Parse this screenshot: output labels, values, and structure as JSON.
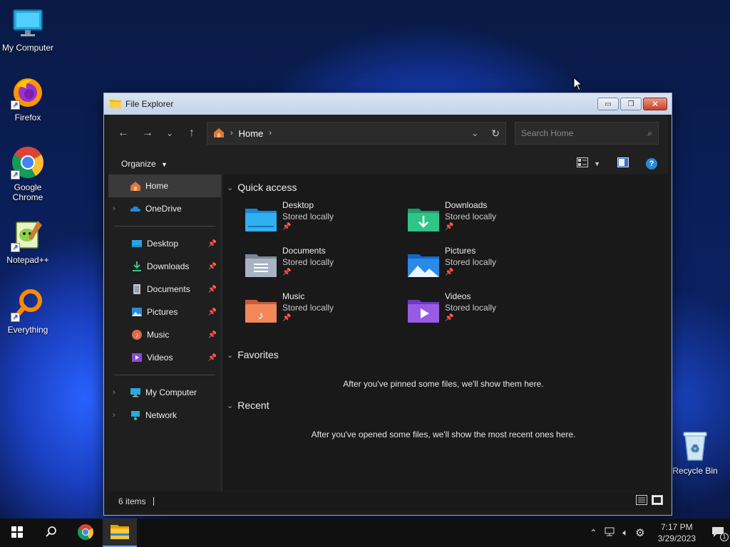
{
  "desktop": {
    "icons": [
      {
        "label": "My Computer"
      },
      {
        "label": "Firefox"
      },
      {
        "label": "Google Chrome"
      },
      {
        "label": "Notepad++"
      },
      {
        "label": "Everything"
      },
      {
        "label": "Recycle Bin"
      }
    ]
  },
  "window": {
    "title": "File Explorer",
    "address": {
      "location": "Home"
    },
    "search": {
      "placeholder": "Search Home"
    },
    "toolbar": {
      "organize_label": "Organize"
    },
    "sidebar": {
      "items": [
        {
          "label": "Home"
        },
        {
          "label": "OneDrive"
        },
        {
          "label": "Desktop"
        },
        {
          "label": "Downloads"
        },
        {
          "label": "Documents"
        },
        {
          "label": "Pictures"
        },
        {
          "label": "Music"
        },
        {
          "label": "Videos"
        },
        {
          "label": "My Computer"
        },
        {
          "label": "Network"
        }
      ]
    },
    "content": {
      "quick_access": {
        "title": "Quick access",
        "items": [
          {
            "name": "Desktop",
            "sub": "Stored locally"
          },
          {
            "name": "Downloads",
            "sub": "Stored locally"
          },
          {
            "name": "Documents",
            "sub": "Stored locally"
          },
          {
            "name": "Pictures",
            "sub": "Stored locally"
          },
          {
            "name": "Music",
            "sub": "Stored locally"
          },
          {
            "name": "Videos",
            "sub": "Stored locally"
          }
        ]
      },
      "favorites": {
        "title": "Favorites",
        "empty_message": "After you've pinned some files, we'll show them here."
      },
      "recent": {
        "title": "Recent",
        "empty_message": "After you've opened some files, we'll show the most recent ones here."
      }
    },
    "status": {
      "item_count": "6 items"
    }
  },
  "taskbar": {
    "clock": {
      "time": "7:17 PM",
      "date": "3/29/2023"
    },
    "notification_count": "1"
  },
  "colors": {
    "accent": "#1e90ff",
    "window_bg": "#191919",
    "titlebar": "#c9d8ec"
  }
}
